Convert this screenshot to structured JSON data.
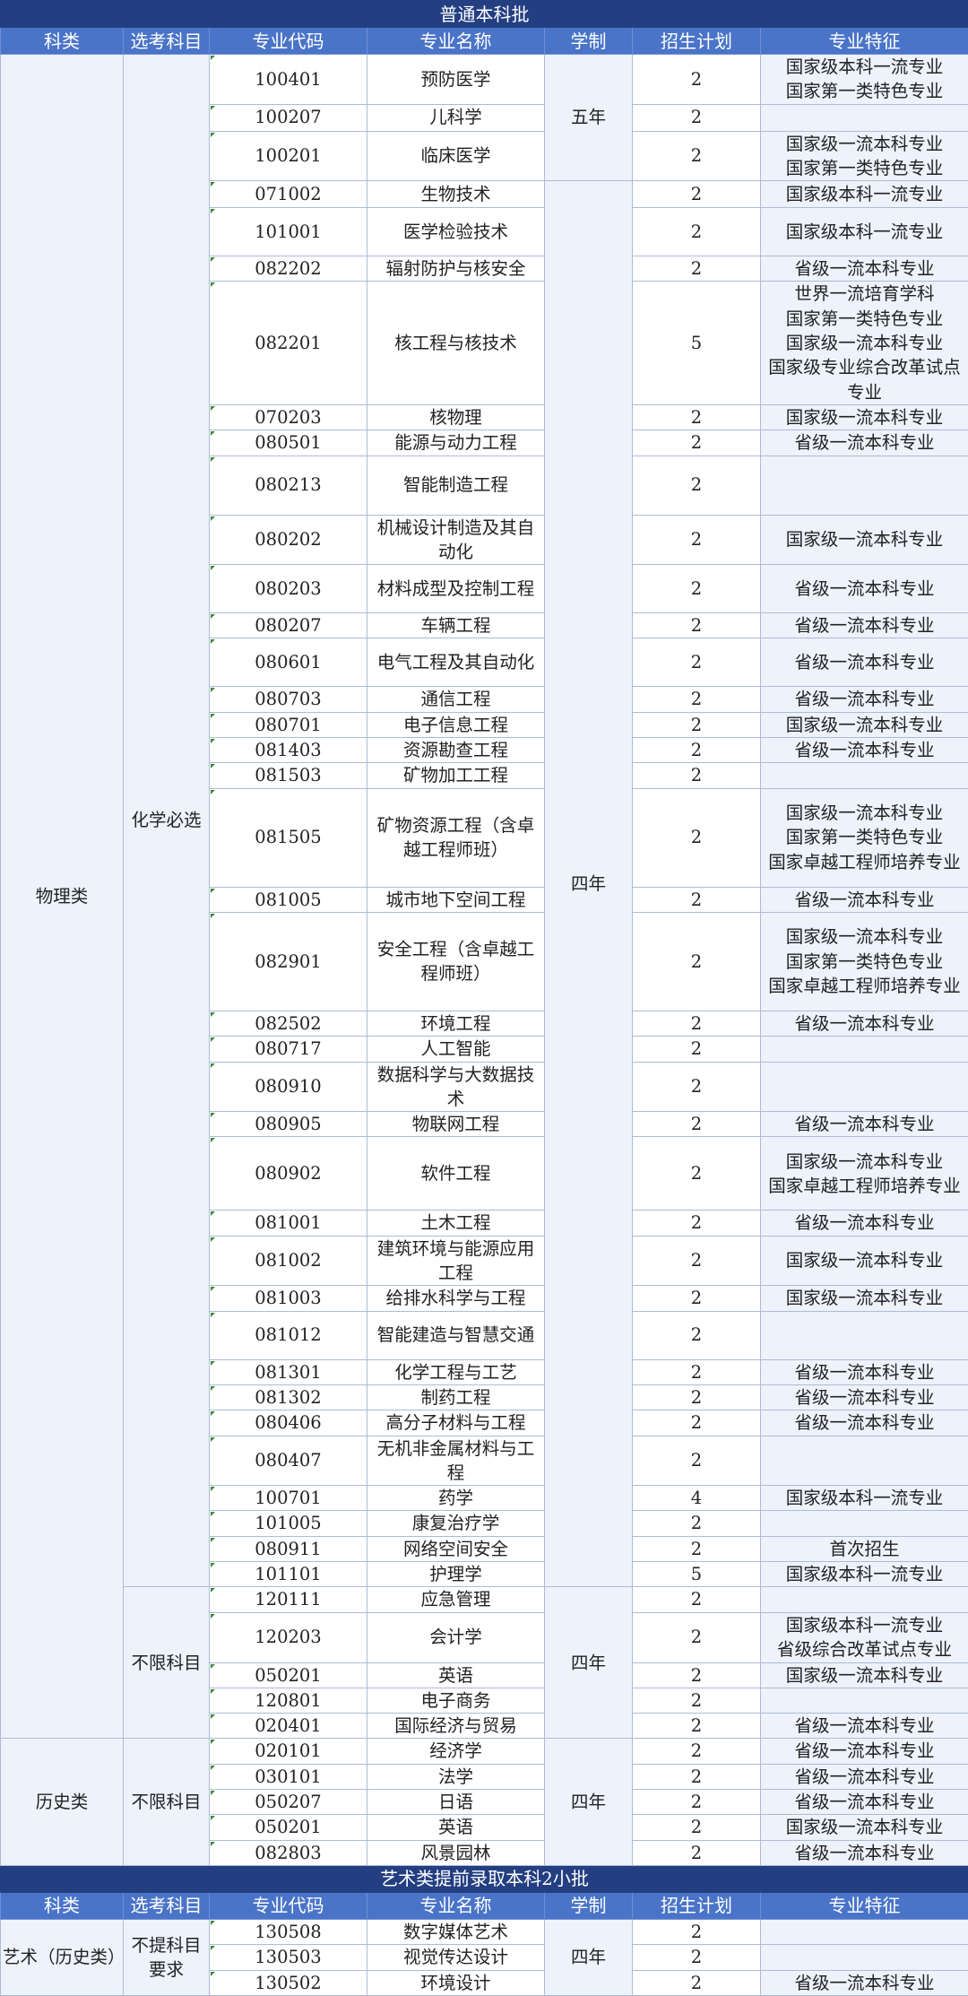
{
  "sections": [
    {
      "title": "普通本科批",
      "headers": [
        "科类",
        "选考科目",
        "专业代码",
        "专业名称",
        "学制",
        "招生计划",
        "专业特征"
      ],
      "groups": [
        {
          "category": "物理类",
          "subgroups": [
            {
              "subject": "化学必选",
              "durations": [
                {
                  "label": "五年",
                  "rows": [
                    {
                      "code": "100401",
                      "name": "预防医学",
                      "plan": "2",
                      "feature": "国家级本科一流专业\n国家第一类特色专业"
                    },
                    {
                      "code": "100207",
                      "name": "儿科学",
                      "plan": "2",
                      "feature": ""
                    },
                    {
                      "code": "100201",
                      "name": "临床医学",
                      "plan": "2",
                      "feature": "国家级一流本科专业\n国家第一类特色专业"
                    }
                  ]
                },
                {
                  "label": "四年",
                  "rows": [
                    {
                      "code": "071002",
                      "name": "生物技术",
                      "plan": "2",
                      "feature": "国家级本科一流专业"
                    },
                    {
                      "code": "101001",
                      "name": "医学检验技术",
                      "plan": "2",
                      "feature": "国家级本科一流专业"
                    },
                    {
                      "code": "082202",
                      "name": "辐射防护与核安全",
                      "plan": "2",
                      "feature": "省级一流本科专业"
                    },
                    {
                      "code": "082201",
                      "name": "核工程与核技术",
                      "plan": "5",
                      "feature": "世界一流培育学科\n国家第一类特色专业\n国家级一流本科专业\n国家级专业综合改革试点专业"
                    },
                    {
                      "code": "070203",
                      "name": "核物理",
                      "plan": "2",
                      "feature": "国家级一流本科专业"
                    },
                    {
                      "code": "080501",
                      "name": "能源与动力工程",
                      "plan": "2",
                      "feature": "省级一流本科专业"
                    },
                    {
                      "code": "080213",
                      "name": "智能制造工程",
                      "plan": "2",
                      "feature": ""
                    },
                    {
                      "code": "080202",
                      "name": "机械设计制造及其自动化",
                      "plan": "2",
                      "feature": "国家级一流本科专业"
                    },
                    {
                      "code": "080203",
                      "name": "材料成型及控制工程",
                      "plan": "2",
                      "feature": "省级一流本科专业"
                    },
                    {
                      "code": "080207",
                      "name": "车辆工程",
                      "plan": "2",
                      "feature": "省级一流本科专业"
                    },
                    {
                      "code": "080601",
                      "name": "电气工程及其自动化",
                      "plan": "2",
                      "feature": "省级一流本科专业"
                    },
                    {
                      "code": "080703",
                      "name": "通信工程",
                      "plan": "2",
                      "feature": "省级一流本科专业"
                    },
                    {
                      "code": "080701",
                      "name": "电子信息工程",
                      "plan": "2",
                      "feature": "国家级一流本科专业"
                    },
                    {
                      "code": "081403",
                      "name": "资源勘查工程",
                      "plan": "2",
                      "feature": "省级一流本科专业"
                    },
                    {
                      "code": "081503",
                      "name": "矿物加工工程",
                      "plan": "2",
                      "feature": ""
                    },
                    {
                      "code": "081505",
                      "name": "矿物资源工程（含卓越工程师班）",
                      "plan": "2",
                      "feature": "国家级一流本科专业\n国家第一类特色专业\n国家卓越工程师培养专业"
                    },
                    {
                      "code": "081005",
                      "name": "城市地下空间工程",
                      "plan": "2",
                      "feature": "省级一流本科专业"
                    },
                    {
                      "code": "082901",
                      "name": "安全工程（含卓越工程师班）",
                      "plan": "2",
                      "feature": "国家级一流本科专业\n国家第一类特色专业\n国家卓越工程师培养专业"
                    },
                    {
                      "code": "082502",
                      "name": "环境工程",
                      "plan": "2",
                      "feature": "省级一流本科专业"
                    },
                    {
                      "code": "080717",
                      "name": "人工智能",
                      "plan": "2",
                      "feature": ""
                    },
                    {
                      "code": "080910",
                      "name": "数据科学与大数据技术",
                      "plan": "2",
                      "feature": ""
                    },
                    {
                      "code": "080905",
                      "name": "物联网工程",
                      "plan": "2",
                      "feature": "省级一流本科专业"
                    },
                    {
                      "code": "080902",
                      "name": "软件工程",
                      "plan": "2",
                      "feature": "国家级一流本科专业\n国家卓越工程师培养专业"
                    },
                    {
                      "code": "081001",
                      "name": "土木工程",
                      "plan": "2",
                      "feature": "省级一流本科专业"
                    },
                    {
                      "code": "081002",
                      "name": "建筑环境与能源应用工程",
                      "plan": "2",
                      "feature": "国家级一流本科专业"
                    },
                    {
                      "code": "081003",
                      "name": "给排水科学与工程",
                      "plan": "2",
                      "feature": "国家级一流本科专业"
                    },
                    {
                      "code": "081012",
                      "name": "智能建造与智慧交通",
                      "plan": "2",
                      "feature": ""
                    },
                    {
                      "code": "081301",
                      "name": "化学工程与工艺",
                      "plan": "2",
                      "feature": "省级一流本科专业"
                    },
                    {
                      "code": "081302",
                      "name": "制药工程",
                      "plan": "2",
                      "feature": "省级一流本科专业"
                    },
                    {
                      "code": "080406",
                      "name": "高分子材料与工程",
                      "plan": "2",
                      "feature": "省级一流本科专业"
                    },
                    {
                      "code": "080407",
                      "name": "无机非金属材料与工程",
                      "plan": "2",
                      "feature": ""
                    },
                    {
                      "code": "100701",
                      "name": "药学",
                      "plan": "4",
                      "feature": "国家级本科一流专业"
                    },
                    {
                      "code": "101005",
                      "name": "康复治疗学",
                      "plan": "2",
                      "feature": ""
                    },
                    {
                      "code": "080911",
                      "name": "网络空间安全",
                      "plan": "2",
                      "feature": "首次招生"
                    },
                    {
                      "code": "101101",
                      "name": "护理学",
                      "plan": "5",
                      "feature": "国家级本科一流专业"
                    }
                  ]
                }
              ]
            },
            {
              "subject": "不限科目",
              "durations": [
                {
                  "label": "四年",
                  "rows": [
                    {
                      "code": "120111",
                      "name": "应急管理",
                      "plan": "2",
                      "feature": ""
                    },
                    {
                      "code": "120203",
                      "name": "会计学",
                      "plan": "2",
                      "feature": "国家级本科一流专业\n省级综合改革试点专业"
                    },
                    {
                      "code": "050201",
                      "name": "英语",
                      "plan": "2",
                      "feature": "国家级一流本科专业"
                    },
                    {
                      "code": "120801",
                      "name": "电子商务",
                      "plan": "2",
                      "feature": ""
                    },
                    {
                      "code": "020401",
                      "name": "国际经济与贸易",
                      "plan": "2",
                      "feature": "省级一流本科专业"
                    }
                  ]
                }
              ]
            }
          ]
        },
        {
          "category": "历史类",
          "subgroups": [
            {
              "subject": "不限科目",
              "durations": [
                {
                  "label": "四年",
                  "rows": [
                    {
                      "code": "020101",
                      "name": "经济学",
                      "plan": "2",
                      "feature": "省级一流本科专业"
                    },
                    {
                      "code": "030101",
                      "name": "法学",
                      "plan": "2",
                      "feature": "省级一流本科专业"
                    },
                    {
                      "code": "050207",
                      "name": "日语",
                      "plan": "2",
                      "feature": "省级一流本科专业"
                    },
                    {
                      "code": "050201",
                      "name": "英语",
                      "plan": "2",
                      "feature": "国家级一流本科专业"
                    },
                    {
                      "code": "082803",
                      "name": "风景园林",
                      "plan": "2",
                      "feature": "省级一流本科专业"
                    }
                  ]
                }
              ]
            }
          ]
        }
      ]
    },
    {
      "title": "艺术类提前录取本科2小批",
      "headers": [
        "科类",
        "选考科目",
        "专业代码",
        "专业名称",
        "学制",
        "招生计划",
        "专业特征"
      ],
      "groups": [
        {
          "category": "艺术（历史类）",
          "subgroups": [
            {
              "subject": "不提科目要求",
              "durations": [
                {
                  "label": "四年",
                  "rows": [
                    {
                      "code": "130508",
                      "name": "数字媒体艺术",
                      "plan": "2",
                      "feature": ""
                    },
                    {
                      "code": "130503",
                      "name": "视觉传达设计",
                      "plan": "2",
                      "feature": ""
                    },
                    {
                      "code": "130502",
                      "name": "环境设计",
                      "plan": "2",
                      "feature": "省级一流本科专业"
                    }
                  ]
                }
              ]
            }
          ]
        }
      ]
    }
  ]
}
